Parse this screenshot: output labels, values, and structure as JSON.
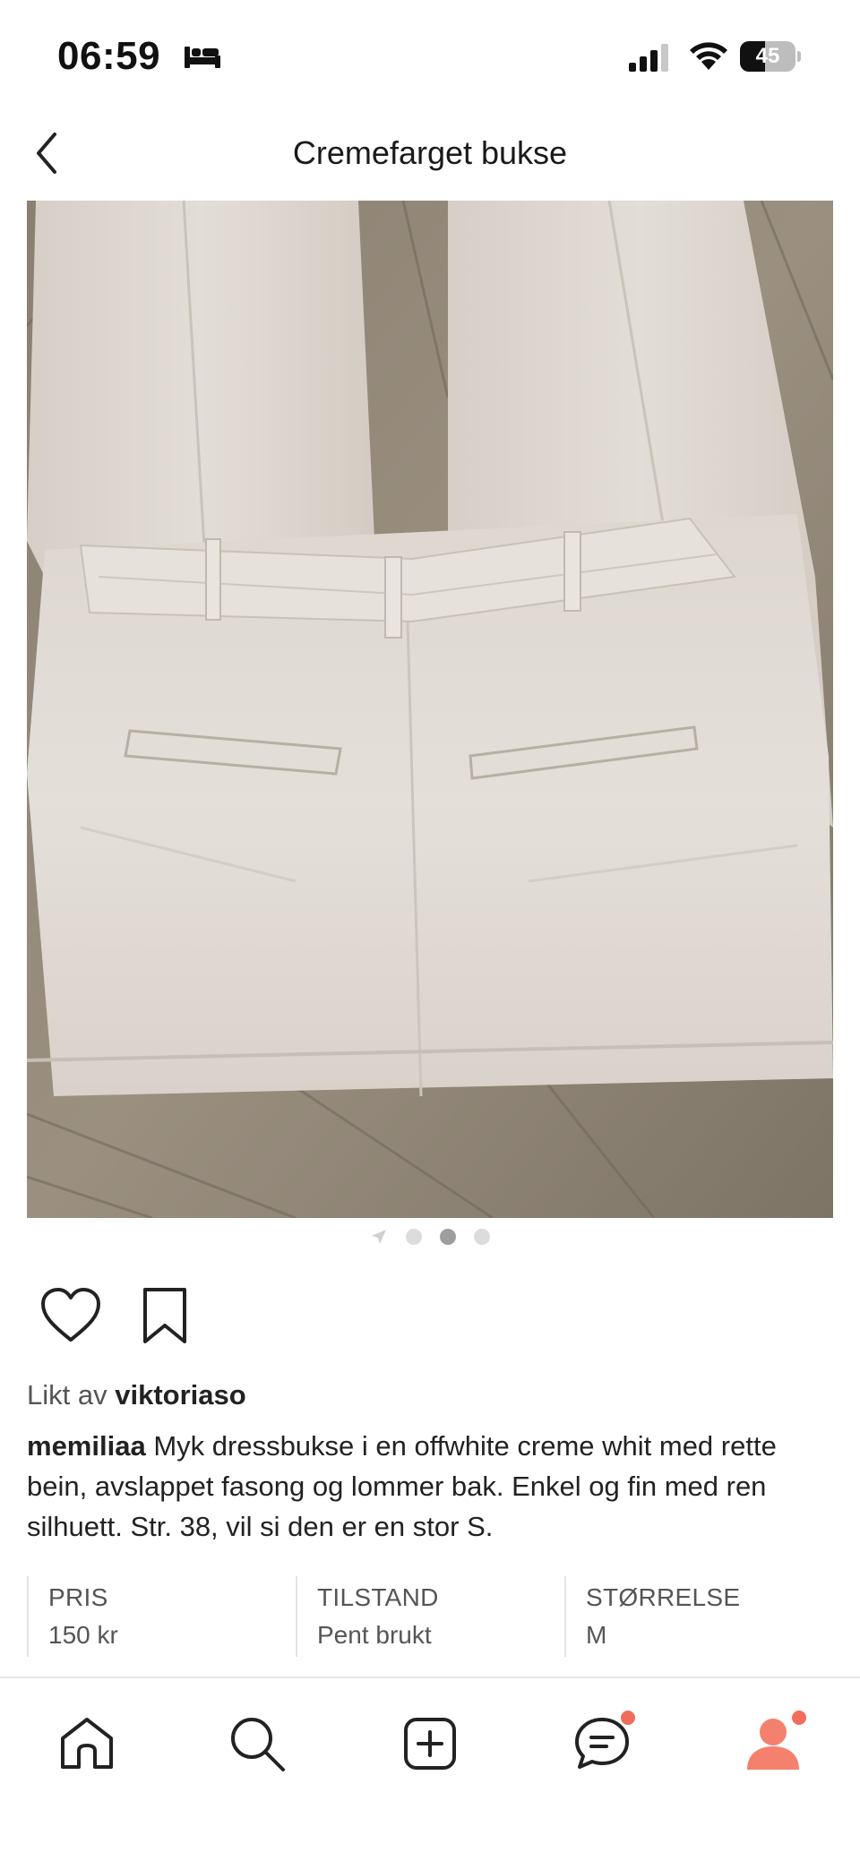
{
  "status_bar": {
    "time": "06:59",
    "battery_level": "45",
    "battery_fraction": 0.45,
    "icons": [
      "sleep-icon",
      "signal-icon",
      "wifi-icon",
      "battery-icon"
    ]
  },
  "header": {
    "back_icon": "chevron-left-icon",
    "title": "Cremefarget bukse"
  },
  "product_image": {
    "alt_icon": "product-photo",
    "carousel": {
      "count": 3,
      "active_index": 1
    }
  },
  "actions": {
    "like_icon": "heart-icon",
    "save_icon": "bookmark-icon"
  },
  "likes": {
    "prefix": "Likt av",
    "user": "viktoriaso"
  },
  "caption": {
    "user": "memiliaa",
    "text": "Myk dressbukse i en offwhite creme whit med rette bein, avslappet fasong og lommer bak. Enkel og fin med ren silhuett. Str. 38, vil si den er en stor S."
  },
  "info": [
    {
      "label": "PRIS",
      "value": "150 kr"
    },
    {
      "label": "TILSTAND",
      "value": "Pent brukt"
    },
    {
      "label": "STØRRELSE",
      "value": "M"
    }
  ],
  "bottom_nav": {
    "items": [
      {
        "name": "home",
        "icon": "home-icon",
        "badge": false
      },
      {
        "name": "search",
        "icon": "search-icon",
        "badge": false
      },
      {
        "name": "add",
        "icon": "plus-square-icon",
        "badge": false
      },
      {
        "name": "messages",
        "icon": "chat-icon",
        "badge": true
      },
      {
        "name": "profile",
        "icon": "profile-icon",
        "badge": true
      }
    ],
    "badge_color": "#F26D5B",
    "profile_color": "#F4806E"
  }
}
